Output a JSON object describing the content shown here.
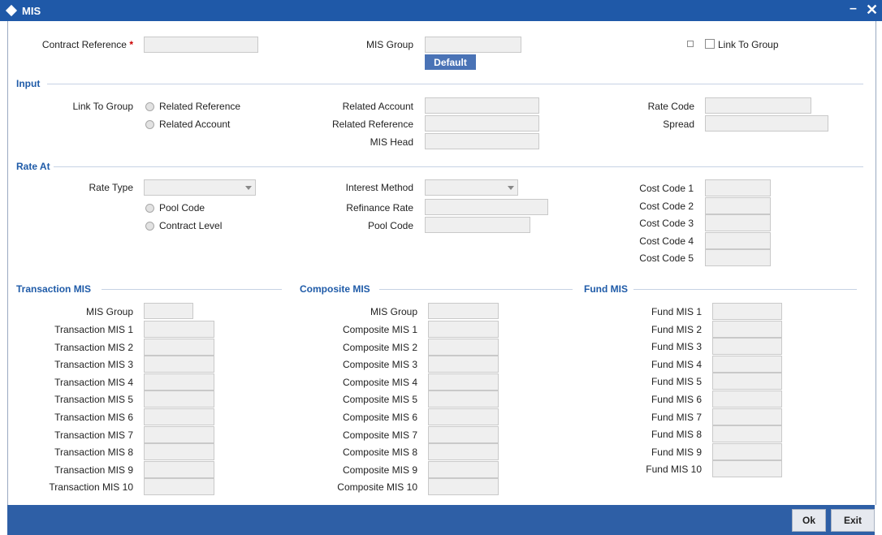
{
  "window": {
    "title": "MIS",
    "minimize": "–",
    "close": "✕"
  },
  "header": {
    "contract_reference_label": "Contract Reference",
    "required_mark": "*",
    "mis_group_label": "MIS Group",
    "default_button": "Default",
    "link_to_group_label": "Link To Group"
  },
  "input": {
    "section": "Input",
    "link_to_group_label": "Link To Group",
    "radio_related_reference": "Related Reference",
    "radio_related_account": "Related Account",
    "related_account_label": "Related Account",
    "related_reference_label": "Related Reference",
    "mis_head_label": "MIS Head",
    "rate_code_label": "Rate Code",
    "spread_label": "Spread"
  },
  "rate_at": {
    "section": "Rate At",
    "rate_type_label": "Rate Type",
    "radio_pool_code": "Pool Code",
    "radio_contract_level": "Contract Level",
    "interest_method_label": "Interest Method",
    "refinance_rate_label": "Refinance Rate",
    "pool_code_label": "Pool Code",
    "cost_codes": [
      "Cost Code 1",
      "Cost Code 2",
      "Cost Code 3",
      "Cost Code 4",
      "Cost Code 5"
    ]
  },
  "transaction_mis": {
    "section": "Transaction MIS",
    "mis_group_label": "MIS Group",
    "fields": [
      "Transaction MIS 1",
      "Transaction MIS 2",
      "Transaction MIS 3",
      "Transaction MIS 4",
      "Transaction MIS 5",
      "Transaction MIS 6",
      "Transaction MIS 7",
      "Transaction MIS 8",
      "Transaction MIS 9",
      "Transaction MIS 10"
    ]
  },
  "composite_mis": {
    "section": "Composite MIS",
    "mis_group_label": "MIS Group",
    "fields": [
      "Composite MIS 1",
      "Composite MIS 2",
      "Composite MIS 3",
      "Composite MIS 4",
      "Composite MIS 5",
      "Composite MIS 6",
      "Composite MIS 7",
      "Composite MIS 8",
      "Composite MIS 9",
      "Composite MIS 10"
    ]
  },
  "fund_mis": {
    "section": "Fund MIS",
    "fields": [
      "Fund MIS 1",
      "Fund MIS 2",
      "Fund MIS 3",
      "Fund MIS 4",
      "Fund MIS 5",
      "Fund MIS 6",
      "Fund MIS 7",
      "Fund MIS 8",
      "Fund MIS 9",
      "Fund MIS 10"
    ]
  },
  "footer": {
    "ok": "Ok",
    "exit": "Exit"
  },
  "colors": {
    "titlebar": "#1f59a8",
    "footer": "#2e5fa6",
    "section": "#1f5ba8"
  }
}
